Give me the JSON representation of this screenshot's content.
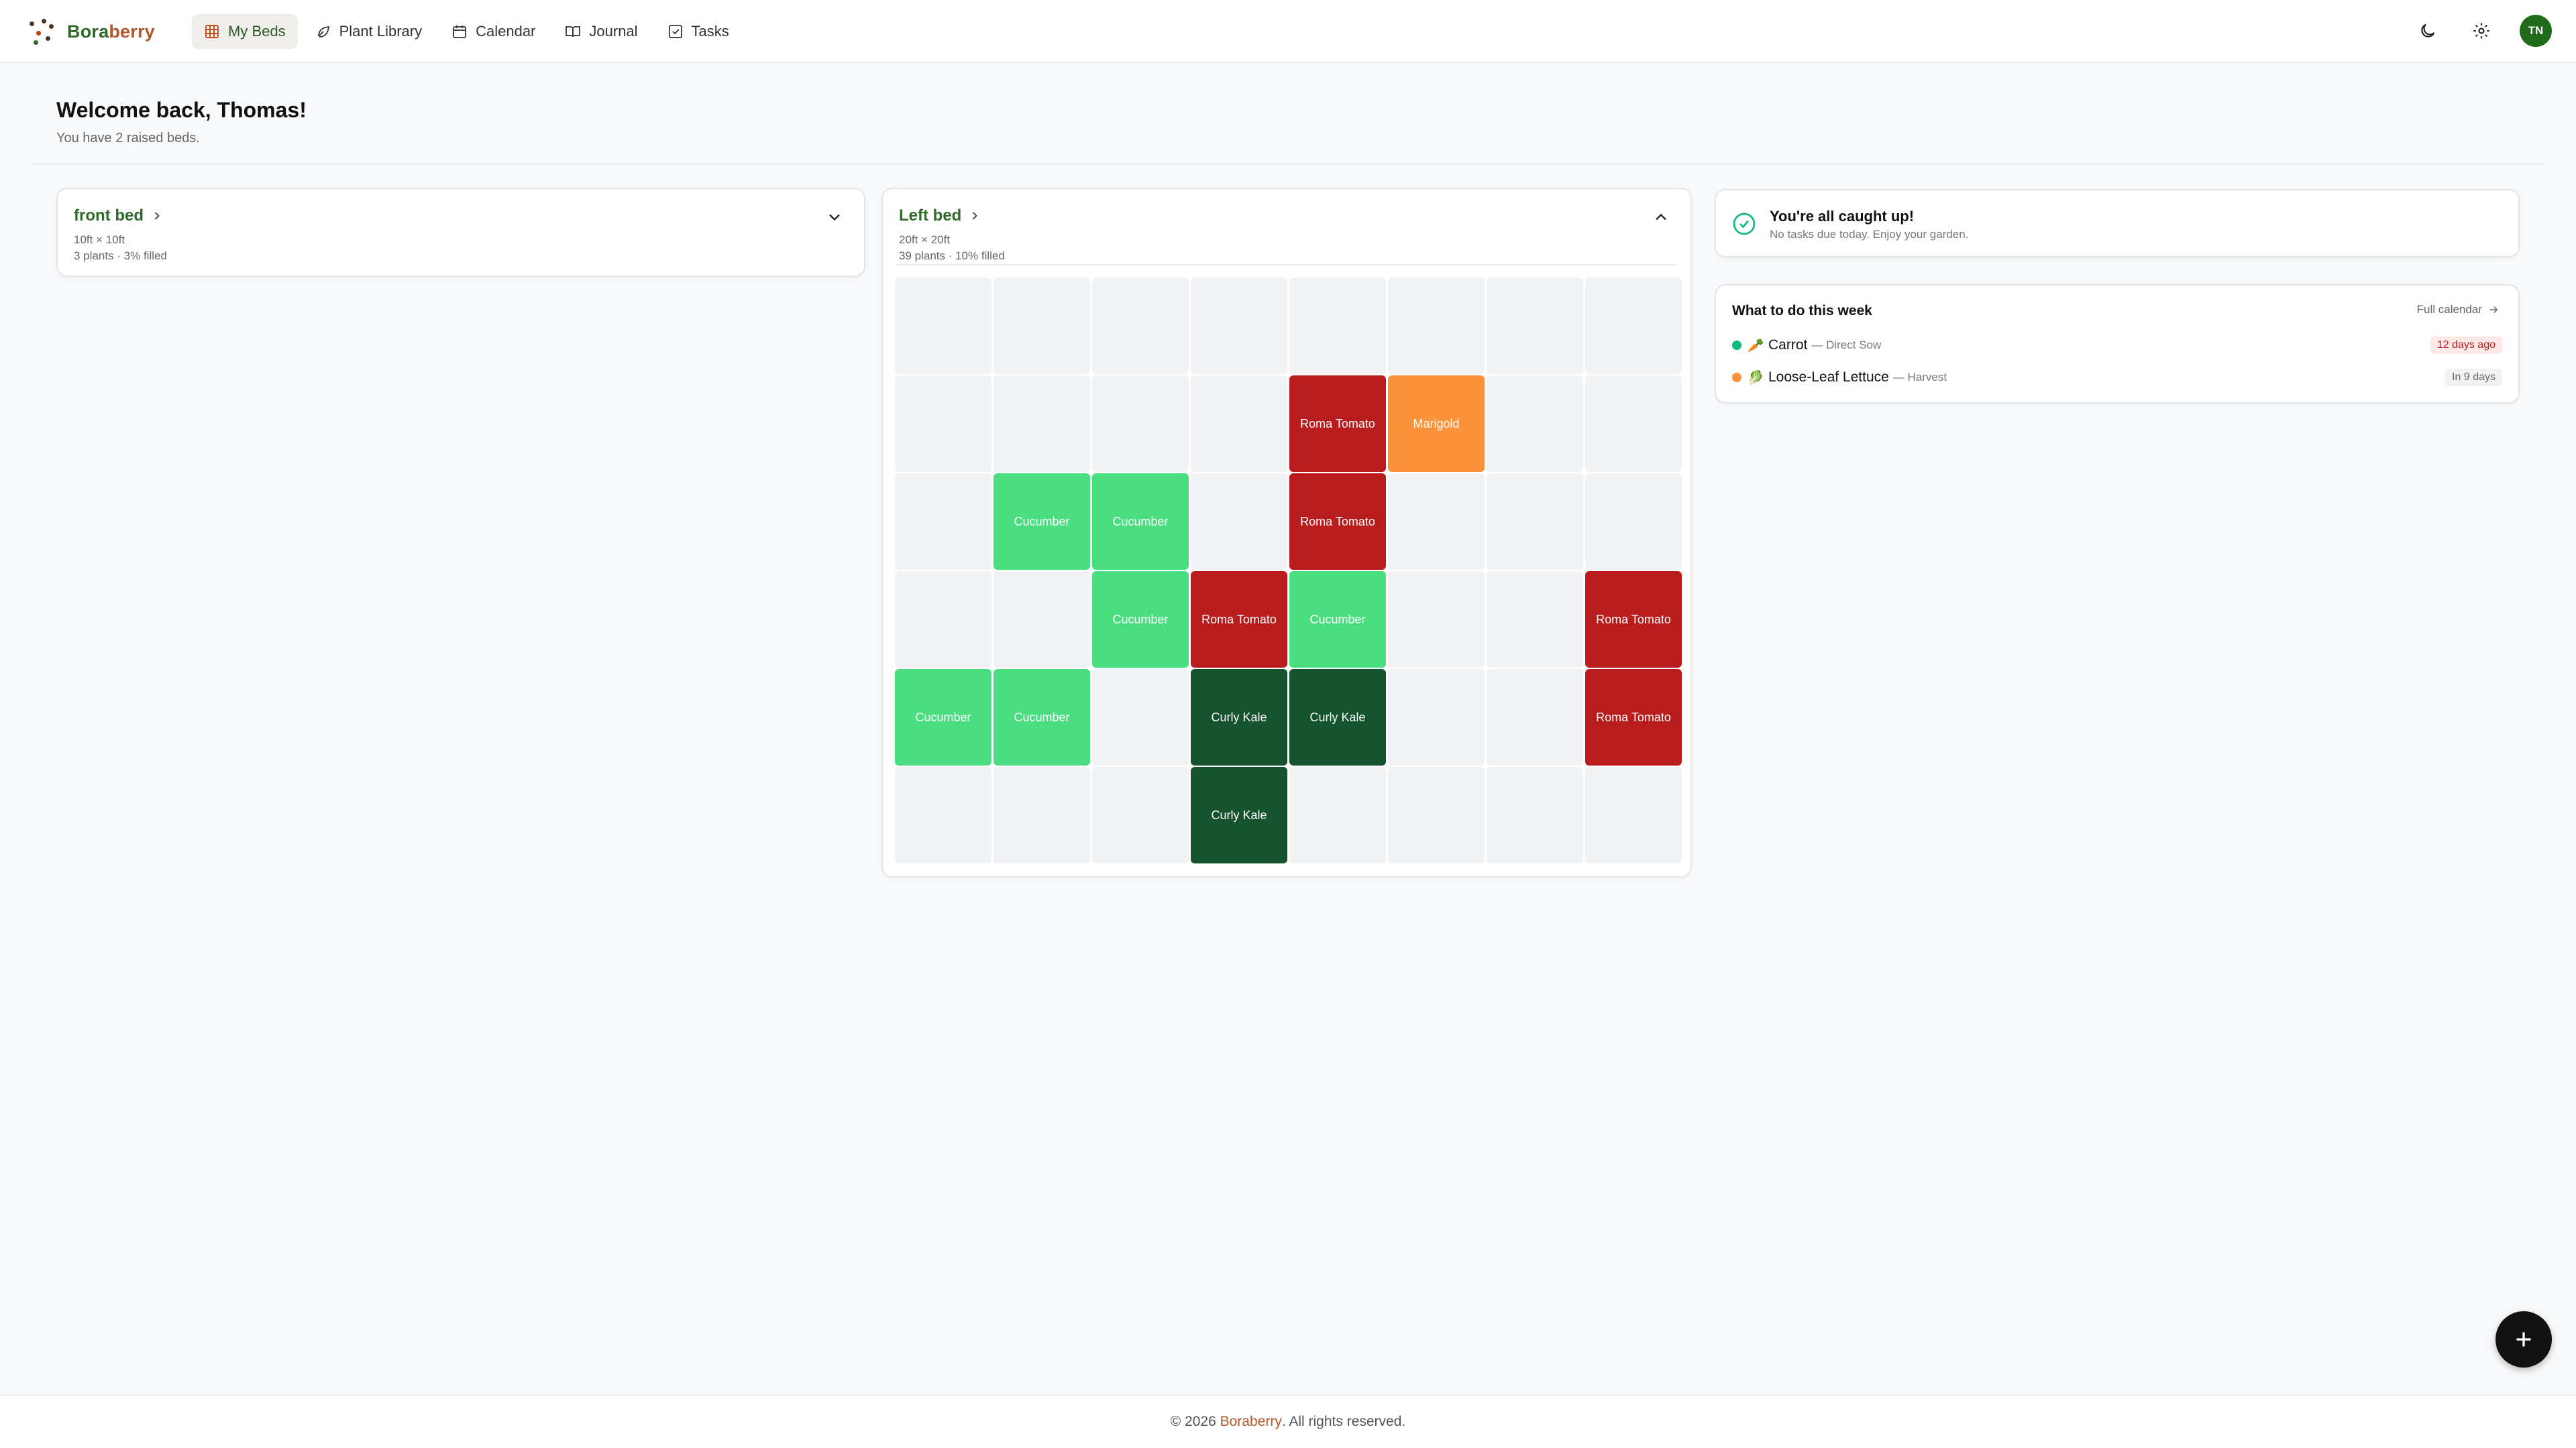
{
  "app": {
    "brand_part1": "Bora",
    "brand_part2": "berry",
    "avatar_initials": "TN"
  },
  "nav": {
    "items": [
      {
        "label": "My Beds",
        "icon": "grid-icon",
        "active": true
      },
      {
        "label": "Plant Library",
        "icon": "leaf-icon"
      },
      {
        "label": "Calendar",
        "icon": "calendar-icon"
      },
      {
        "label": "Journal",
        "icon": "book-icon"
      },
      {
        "label": "Tasks",
        "icon": "checkbox-icon"
      }
    ]
  },
  "welcome": {
    "title": "Welcome back, Thomas!",
    "subtitle": "You have 2 raised beds."
  },
  "beds": [
    {
      "name": "front bed",
      "dimensions": "10ft × 10ft",
      "summary": "3 plants · 3% filled",
      "expanded": false
    },
    {
      "name": "Left bed",
      "dimensions": "20ft × 20ft",
      "summary": "39 plants · 10% filled",
      "expanded": true,
      "grid_columns": 8,
      "grid": [
        [
          "",
          "",
          "",
          "",
          "",
          "",
          "",
          ""
        ],
        [
          "",
          "",
          "",
          "",
          "Roma Tomato",
          "Marigold",
          "",
          ""
        ],
        [
          "",
          "Cucumber",
          "Cucumber",
          "",
          "Roma Tomato",
          "",
          "",
          ""
        ],
        [
          "",
          "",
          "Cucumber",
          "Roma Tomato",
          "Cucumber",
          "",
          "",
          "Roma Tomato"
        ],
        [
          "Cucumber",
          "Cucumber",
          "",
          "Curly Kale",
          "Curly Kale",
          "",
          "",
          "Roma Tomato"
        ],
        [
          "",
          "",
          "",
          "Curly Kale",
          "",
          "",
          "",
          ""
        ]
      ]
    }
  ],
  "plant_colors": {
    "Roma Tomato": "#b91c1c",
    "Cucumber": "#4ade80",
    "Curly Kale": "#14532d",
    "Marigold": "#fb923c"
  },
  "caught_up": {
    "title": "You're all caught up!",
    "subtitle": "No tasks due today. Enjoy your garden."
  },
  "week": {
    "title": "What to do this week",
    "full_calendar": "Full calendar",
    "tasks": [
      {
        "dot_color": "#10b981",
        "emoji": "🥕",
        "plant": "Carrot",
        "action": "— Direct Sow",
        "when": "12 days ago",
        "overdue": true
      },
      {
        "dot_color": "#fb923c",
        "emoji": "🥬",
        "plant": "Loose-Leaf Lettuce",
        "action": "— Harvest",
        "when": "In 9 days",
        "overdue": false
      }
    ]
  },
  "footer": {
    "prefix": "© 2026 ",
    "brand": "Boraberry",
    "suffix": ". All rights reserved."
  }
}
